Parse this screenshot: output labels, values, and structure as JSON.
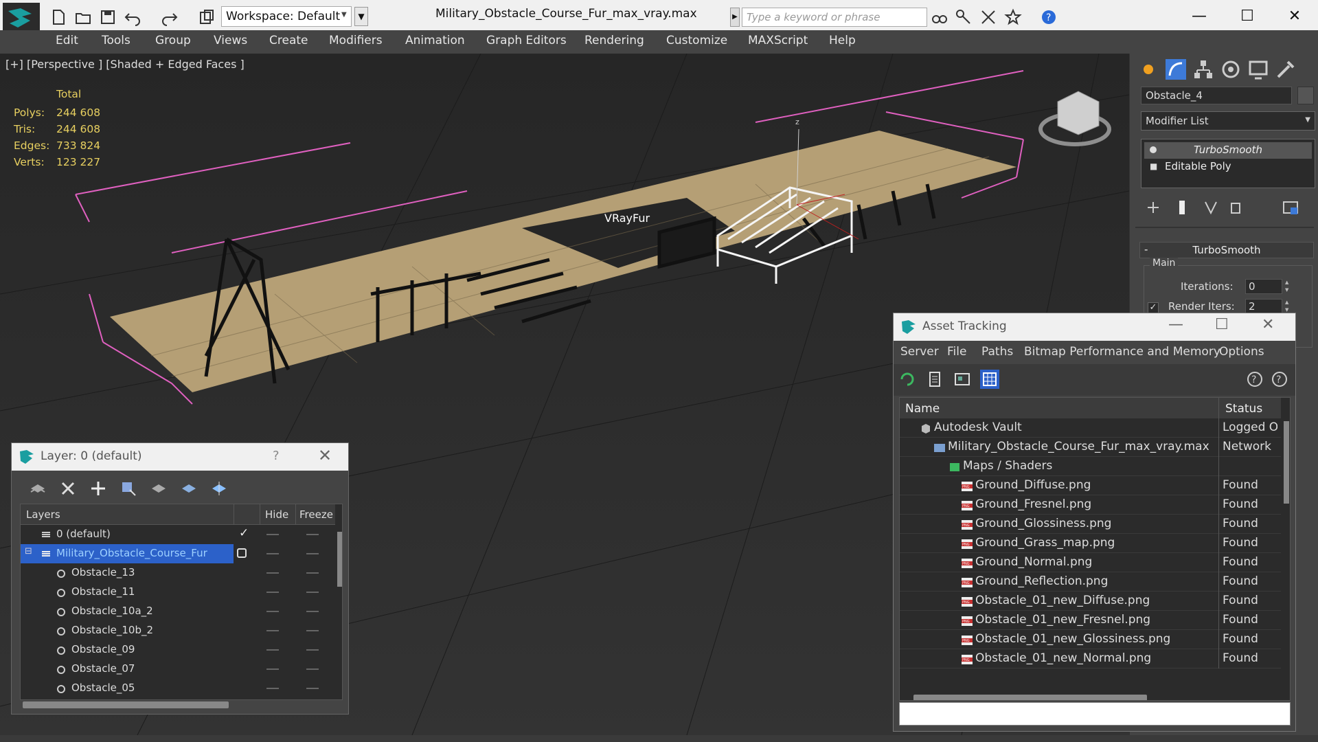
{
  "titlebar": {
    "workspace": "Workspace: Default",
    "document_title": "Military_Obstacle_Course_Fur_max_vray.max",
    "search_placeholder": "Type a keyword or phrase",
    "minimize": "—",
    "maximize": "☐",
    "close": "✕"
  },
  "menu": {
    "items": [
      "Edit",
      "Tools",
      "Group",
      "Views",
      "Create",
      "Modifiers",
      "Animation",
      "Graph Editors",
      "Rendering",
      "Customize",
      "MAXScript",
      "Help"
    ]
  },
  "viewport": {
    "label": "[+] [Perspective ] [Shaded + Edged Faces ]",
    "stats": {
      "total_label": "Total",
      "rows": [
        {
          "label": "Polys:",
          "value": "244 608"
        },
        {
          "label": "Tris:",
          "value": "244 608"
        },
        {
          "label": "Edges:",
          "value": "733 824"
        },
        {
          "label": "Verts:",
          "value": "123 227"
        }
      ]
    },
    "object_label": "VRayFur"
  },
  "command_panel": {
    "object_name": "Obstacle_4",
    "modifier_list": "Modifier List",
    "stack": [
      "TurboSmooth",
      "Editable Poly"
    ],
    "rollout_title": "TurboSmooth",
    "rollout_minus": "-",
    "group_main": "Main",
    "iterations_label": "Iterations:",
    "iterations_value": "0",
    "render_iters_label": "Render Iters:",
    "render_iters_value": "2",
    "render_iters_checked": "✓"
  },
  "layer_dialog": {
    "title": "Layer: 0 (default)",
    "help": "?",
    "close": "✕",
    "columns": {
      "layers": "Layers",
      "hide": "Hide",
      "freeze": "Freeze"
    },
    "rows": [
      {
        "name": "0 (default)",
        "check": "✓"
      },
      {
        "name": "Military_Obstacle_Course_Fur",
        "check": ""
      },
      {
        "name": "Obstacle_13"
      },
      {
        "name": "Obstacle_11"
      },
      {
        "name": "Obstacle_10a_2"
      },
      {
        "name": "Obstacle_10b_2"
      },
      {
        "name": "Obstacle_09"
      },
      {
        "name": "Obstacle_07"
      },
      {
        "name": "Obstacle_05"
      }
    ]
  },
  "asset_tracking": {
    "title": "Asset Tracking",
    "minimize": "—",
    "maximize": "☐",
    "close": "✕",
    "menu": [
      "Server",
      "File",
      "Paths",
      "Bitmap Performance and Memory",
      "Options"
    ],
    "columns": {
      "name": "Name",
      "status": "Status"
    },
    "rows": [
      {
        "name": "Autodesk Vault",
        "status": "Logged O"
      },
      {
        "name": "Military_Obstacle_Course_Fur_max_vray.max",
        "status": "Network"
      },
      {
        "name": "Maps / Shaders",
        "status": ""
      },
      {
        "name": "Ground_Diffuse.png",
        "status": "Found"
      },
      {
        "name": "Ground_Fresnel.png",
        "status": "Found"
      },
      {
        "name": "Ground_Glossiness.png",
        "status": "Found"
      },
      {
        "name": "Ground_Grass_map.png",
        "status": "Found"
      },
      {
        "name": "Ground_Normal.png",
        "status": "Found"
      },
      {
        "name": "Ground_Reflection.png",
        "status": "Found"
      },
      {
        "name": "Obstacle_01_new_Diffuse.png",
        "status": "Found"
      },
      {
        "name": "Obstacle_01_new_Fresnel.png",
        "status": "Found"
      },
      {
        "name": "Obstacle_01_new_Glossiness.png",
        "status": "Found"
      },
      {
        "name": "Obstacle_01_new_Normal.png",
        "status": "Found"
      }
    ],
    "png_badge": "PNG"
  }
}
